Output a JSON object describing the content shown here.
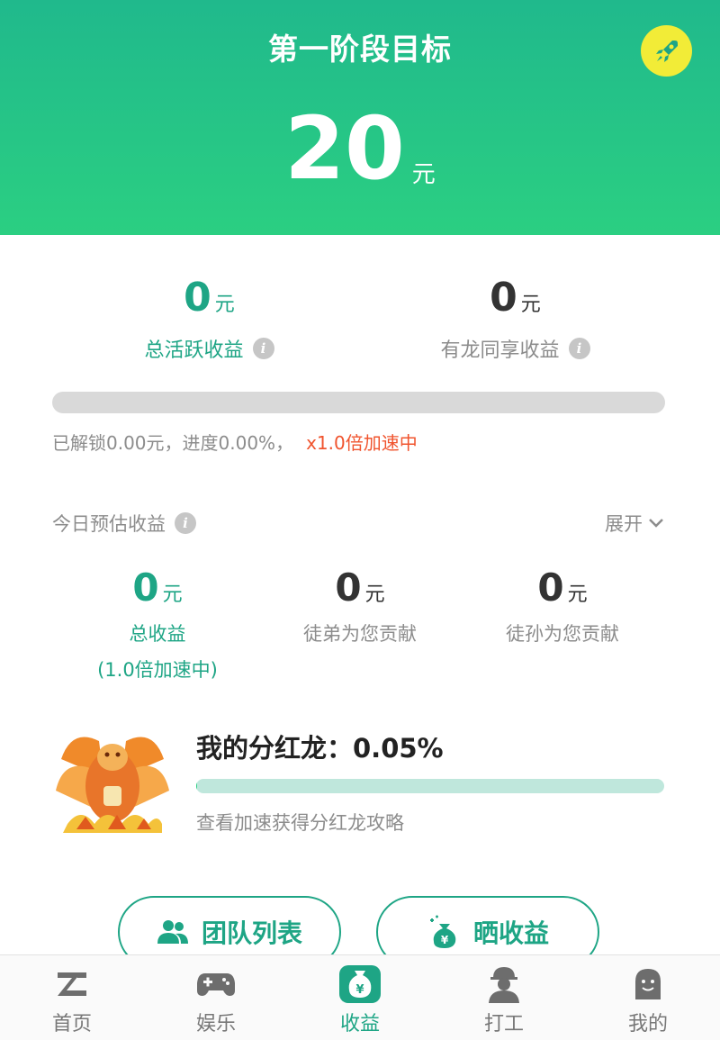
{
  "header": {
    "title": "第一阶段目标",
    "target_value": "20",
    "target_unit": "元"
  },
  "totals": {
    "active": {
      "value": "0",
      "unit": "元",
      "label": "总活跃收益"
    },
    "shared": {
      "value": "0",
      "unit": "元",
      "label": "有龙同享收益"
    }
  },
  "progress": {
    "fraction": 0.0,
    "text": "已解锁0.00元，进度0.00%，",
    "speed_text": "x1.0倍加速中"
  },
  "today": {
    "title": "今日预估收益",
    "expand_label": "展开",
    "items": [
      {
        "value": "0",
        "unit": "元",
        "label": "总收益",
        "sub": "(1.0倍加速中)"
      },
      {
        "value": "0",
        "unit": "元",
        "label": "徒弟为您贡献"
      },
      {
        "value": "0",
        "unit": "元",
        "label": "徒孙为您贡献"
      }
    ]
  },
  "dragon": {
    "title": "我的分红龙：0.05%",
    "fraction": 0.0005,
    "link": "查看加速获得分红龙攻略"
  },
  "buttons": {
    "team_list": "团队列表",
    "share_income": "晒收益"
  },
  "tabbar": {
    "items": [
      {
        "label": "首页",
        "icon": "home-z-icon"
      },
      {
        "label": "娱乐",
        "icon": "gamepad-icon"
      },
      {
        "label": "收益",
        "icon": "money-bag-icon",
        "active": true
      },
      {
        "label": "打工",
        "icon": "worker-icon"
      },
      {
        "label": "我的",
        "icon": "profile-face-icon"
      }
    ]
  },
  "colors": {
    "primary": "#1ea585",
    "header_gradient_top": "#20b98c",
    "header_gradient_bottom": "#2bcf82",
    "speed_text": "#f0542e",
    "rocket_button": "#f2ec37"
  }
}
